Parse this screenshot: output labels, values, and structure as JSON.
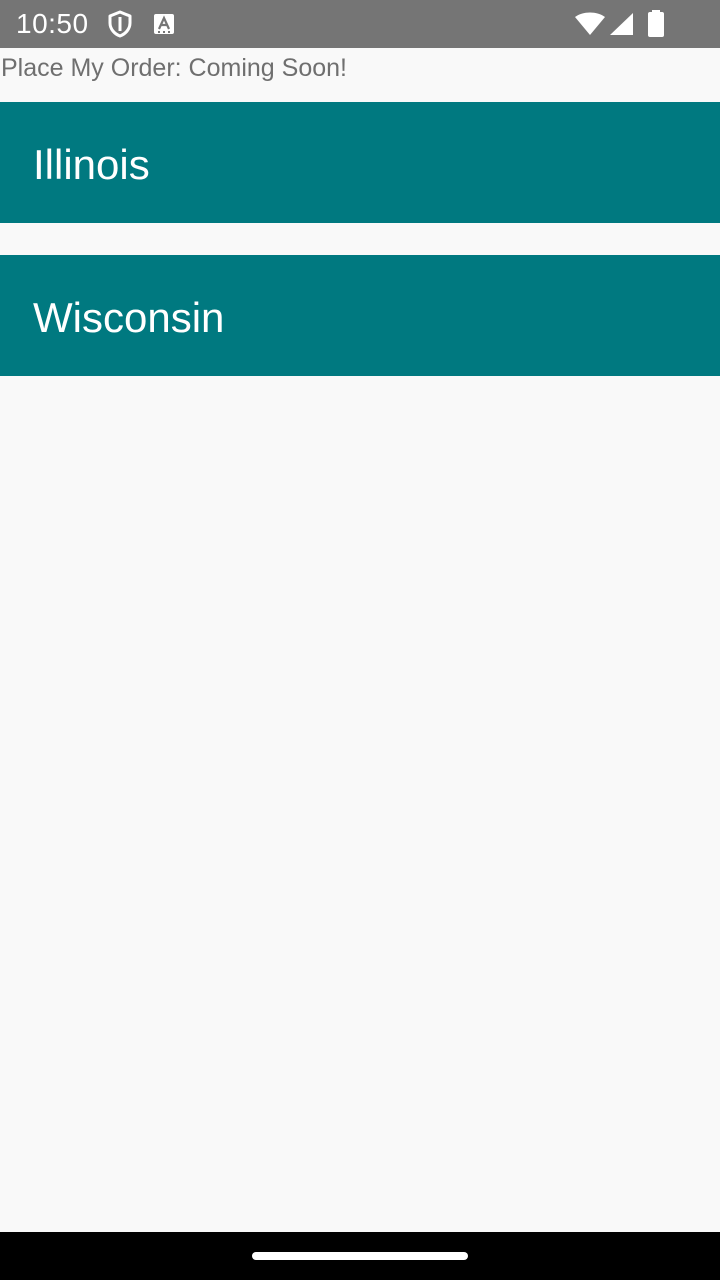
{
  "status_bar": {
    "time": "10:50",
    "icons": [
      "shield-icon",
      "accessibility-text-icon",
      "wifi-icon",
      "cell-signal-icon",
      "battery-icon"
    ],
    "background_color": "#757575"
  },
  "app": {
    "title": "Place My Order: Coming Soon!"
  },
  "regions": {
    "accent_color": "#007980",
    "items": [
      {
        "label": "Illinois"
      },
      {
        "label": "Wisconsin"
      }
    ]
  },
  "nav_bar": {
    "icons": [
      "home-handle-icon"
    ]
  }
}
